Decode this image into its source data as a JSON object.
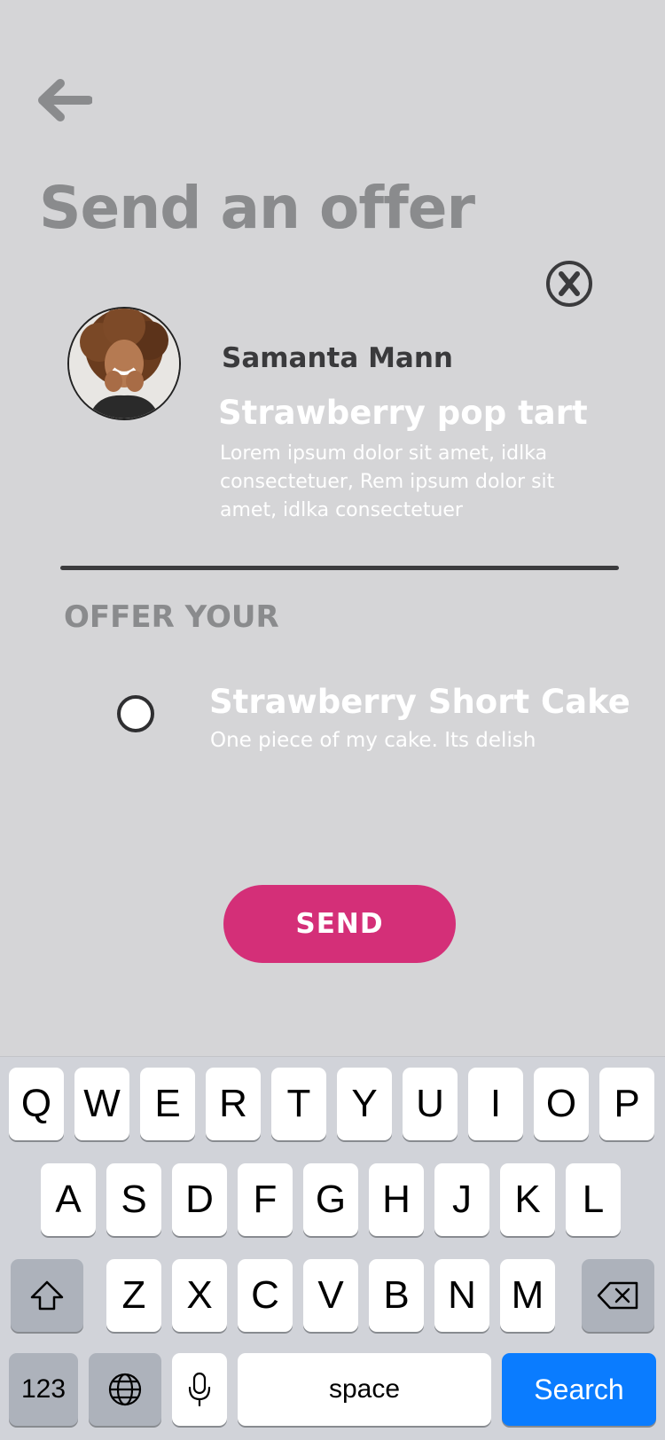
{
  "header": {
    "title": "Send an offer"
  },
  "listing": {
    "seller_name": "Samanta Mann",
    "item_title": "Strawberry pop tart",
    "item_description": "Lorem ipsum dolor sit amet, idlka consectetuer, Rem ipsum dolor sit amet, idlka consectetuer"
  },
  "offer": {
    "section_label": "OFFER YOUR",
    "option_title": "Strawberry Short Cake",
    "option_subtitle": "One piece of my cake. Its delish"
  },
  "actions": {
    "send_label": "SEND"
  },
  "keyboard": {
    "row1": [
      "Q",
      "W",
      "E",
      "R",
      "T",
      "Y",
      "U",
      "I",
      "O",
      "P"
    ],
    "row2": [
      "A",
      "S",
      "D",
      "F",
      "G",
      "H",
      "J",
      "K",
      "L"
    ],
    "row3": [
      "Z",
      "X",
      "C",
      "V",
      "B",
      "N",
      "M"
    ],
    "numbers_label": "123",
    "space_label": "space",
    "search_label": "Search"
  },
  "colors": {
    "background": "#d5d5d7",
    "send_button": "#d42f78",
    "search_key": "#0a7cff"
  }
}
